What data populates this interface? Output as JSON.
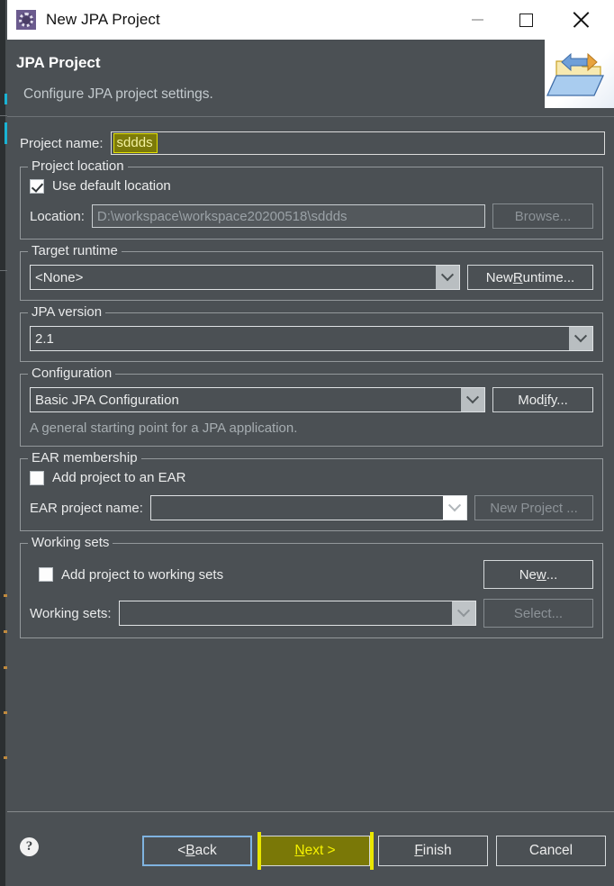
{
  "window": {
    "title": "New JPA Project",
    "icon": "jpa-project-icon",
    "controls": {
      "minimize": "minimize-icon",
      "maximize": "maximize-icon",
      "close": "close-icon"
    }
  },
  "wizard_header": {
    "title": "JPA Project",
    "subtitle": "Configure JPA project settings.",
    "banner_icon": "folder-transfer-icon"
  },
  "form": {
    "project_name": {
      "label": "Project name:",
      "value": "sddds",
      "selected": true
    },
    "project_location": {
      "group_label": "Project location",
      "use_default_label": "Use default location",
      "use_default_checked": true,
      "location_label": "Location:",
      "location_value": "D:\\workspace\\workspace20200518\\sddds",
      "browse_label": "Browse..."
    },
    "target_runtime": {
      "group_label": "Target runtime",
      "value": "<None>",
      "new_runtime_label": "New Runtime..."
    },
    "jpa_version": {
      "group_label": "JPA version",
      "value": "2.1"
    },
    "configuration": {
      "group_label": "Configuration",
      "value": "Basic JPA Configuration",
      "modify_label": "Modify...",
      "description": "A general starting point for a JPA application."
    },
    "ear_membership": {
      "group_label": "EAR membership",
      "add_to_ear_label": "Add project to an EAR",
      "add_to_ear_checked": false,
      "ear_project_name_label": "EAR project name:",
      "ear_project_name_value": "",
      "new_project_label": "New Project ..."
    },
    "working_sets": {
      "group_label": "Working sets",
      "add_to_working_sets_label": "Add project to working sets",
      "add_to_working_sets_checked": false,
      "new_label": "New...",
      "working_sets_label": "Working sets:",
      "working_sets_value": "",
      "select_label": "Select..."
    }
  },
  "button_bar": {
    "help_glyph": "?",
    "back_label": "< Back",
    "next_label": "Next >",
    "finish_label": "Finish",
    "cancel_label": "Cancel"
  },
  "colors": {
    "dialog_bg": "#4b5054",
    "titlebar_bg": "#ffffff",
    "text": "#eceded",
    "highlight_yellow": "#e9e600",
    "highlight_bg": "#7a7807",
    "focus_blue": "#7fb3e0",
    "disabled_text": "#8d9398"
  }
}
